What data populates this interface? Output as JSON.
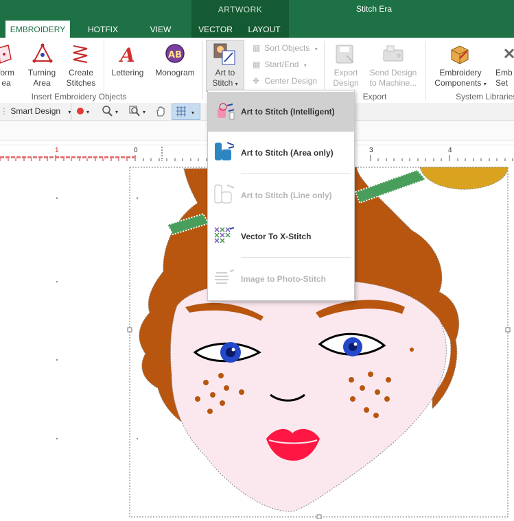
{
  "window": {
    "context_header": "ARTWORK",
    "app_title": "Stitch Era"
  },
  "tabs": [
    {
      "label": "EMBROIDERY"
    },
    {
      "label": "HOTFIX"
    },
    {
      "label": "VIEW"
    },
    {
      "label": "VECTOR"
    },
    {
      "label": "LAYOUT"
    }
  ],
  "ribbon": {
    "form_area": {
      "line1": "form",
      "line2": "ea"
    },
    "turning_area": {
      "line1": "Turning",
      "line2": "Area"
    },
    "create_stitches": {
      "line1": "Create",
      "line2": "Stitches"
    },
    "lettering": "Lettering",
    "monogram": "Monogram",
    "art_to_stitch": {
      "line1": "Art to",
      "line2": "Stitch"
    },
    "sort_objects": "Sort Objects",
    "start_end": "Start/End",
    "center_design": "Center Design",
    "export_design": {
      "line1": "Export",
      "line2": "Design"
    },
    "send_design": {
      "line1": "Send Design",
      "line2": "to Machine..."
    },
    "embroidery_components": {
      "line1": "Embroidery",
      "line2": "Components"
    },
    "emb_settings": {
      "line1": "Emb",
      "line2": "Set"
    },
    "groups": {
      "insert": "Insert Embroidery Objects",
      "export": "Export",
      "libraries": "System Libraries"
    }
  },
  "toolbar": {
    "smart_design": "Smart Design"
  },
  "ruler": {
    "ticks": [
      "1",
      "0",
      "3",
      "4"
    ]
  },
  "menu": {
    "items": [
      {
        "label": "Art to Stitch (Intelligent)",
        "enabled": true,
        "highlighted": true
      },
      {
        "label": "Art to Stitch (Area only)",
        "enabled": true,
        "highlighted": false
      },
      {
        "label": "Art to Stitch (Line only)",
        "enabled": false,
        "highlighted": false
      },
      {
        "label": "Vector To X-Stitch",
        "enabled": true,
        "highlighted": false
      },
      {
        "label": "Image to Photo-Stitch",
        "enabled": false,
        "highlighted": false
      }
    ]
  },
  "colors": {
    "ribbon_green": "#1e7145",
    "context_green": "#145a32",
    "hair": "#b8560f",
    "skin": "#fbe8ee",
    "lips": "#ff1744",
    "eye_blue": "#2448c9",
    "leaf_green": "#4a9e5c",
    "yellow": "#d9a21f"
  }
}
